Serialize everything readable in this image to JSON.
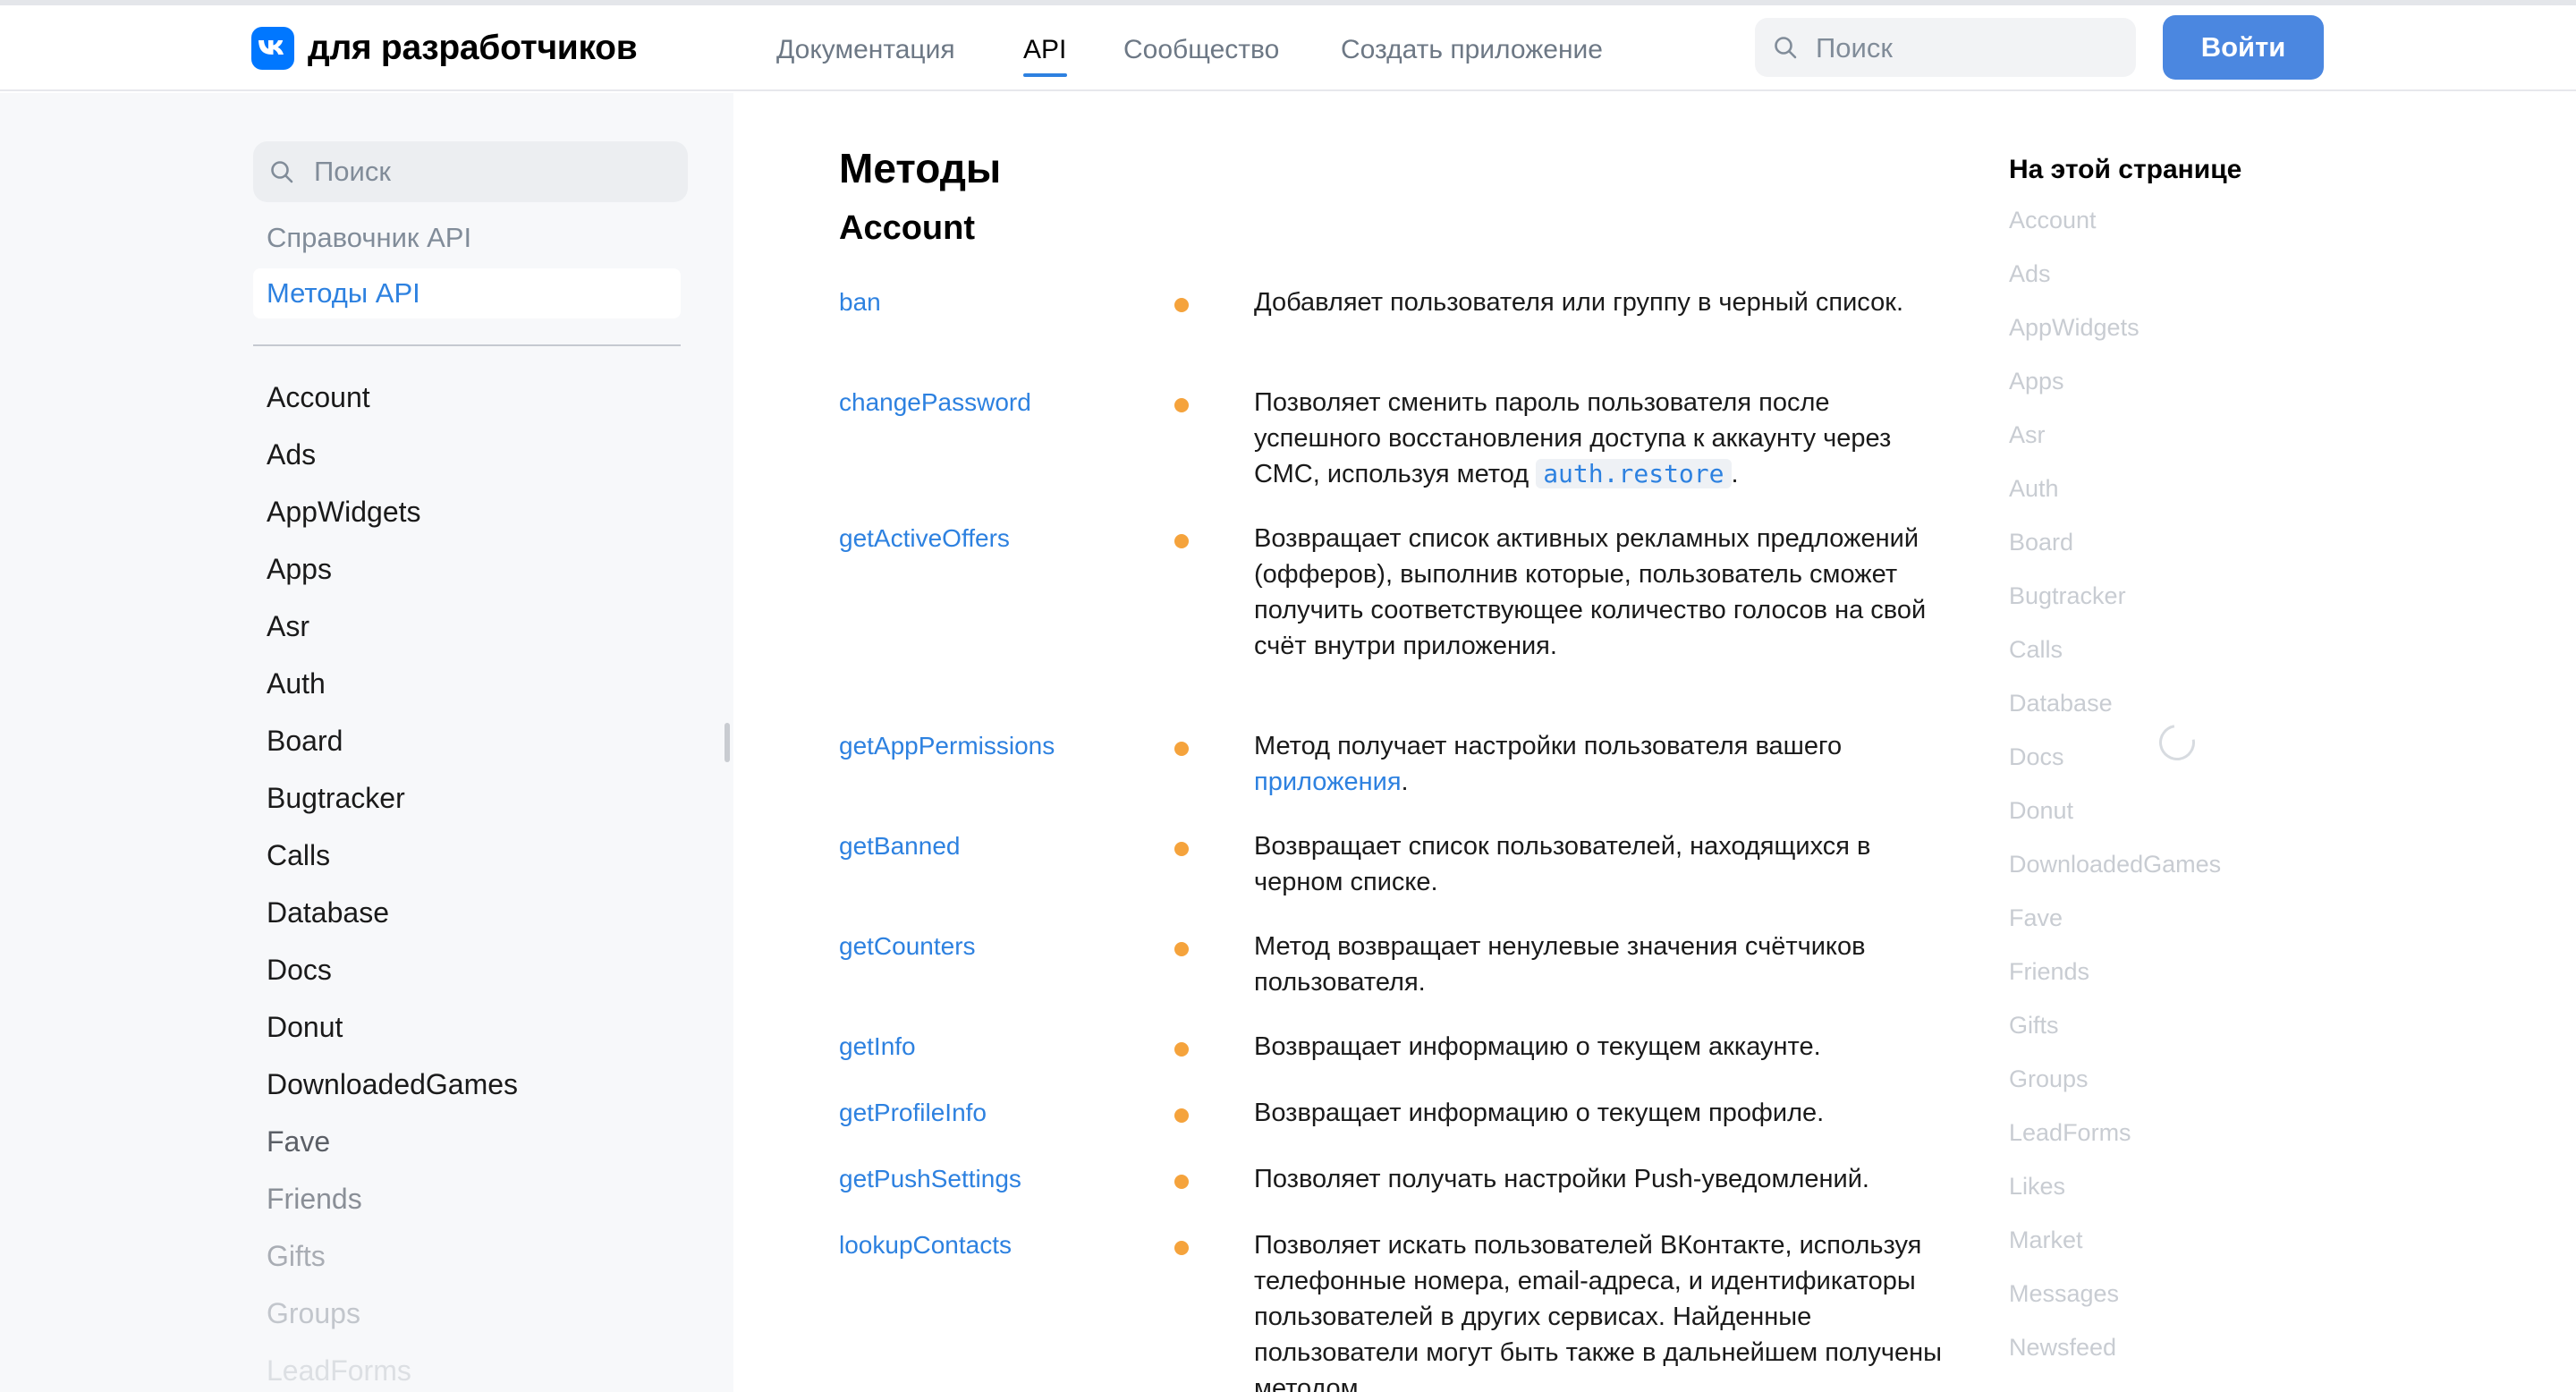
{
  "header": {
    "logo_text": "для разработчиков",
    "nav": [
      "Документация",
      "API",
      "Сообщество",
      "Создать приложение"
    ],
    "search_placeholder": "Поиск",
    "login_label": "Войти"
  },
  "sidebar": {
    "search_placeholder": "Поиск",
    "reference_label": "Справочник API",
    "methods_label": "Методы API",
    "items": [
      "Account",
      "Ads",
      "AppWidgets",
      "Apps",
      "Asr",
      "Auth",
      "Board",
      "Bugtracker",
      "Calls",
      "Database",
      "Docs",
      "Donut",
      "DownloadedGames",
      "Fave",
      "Friends",
      "Gifts",
      "Groups",
      "LeadForms"
    ]
  },
  "main": {
    "title": "Методы",
    "section": "Account",
    "methods": [
      {
        "name": "ban",
        "desc": "Добавляет пользователя или группу в черный список."
      },
      {
        "name": "changePassword",
        "desc_before": "Позволяет сменить пароль пользователя после успешного восстановления доступа к аккаунту через СМС, используя метод ",
        "code": "auth.restore",
        "desc_after": "."
      },
      {
        "name": "getActiveOffers",
        "desc": "Возвращает список активных рекламных предложений (офферов), выполнив которые, пользователь сможет получить соответствующее количество голосов на свой счёт внутри приложения."
      },
      {
        "name": "getAppPermissions",
        "desc_before": "Метод получает настройки пользователя вашего ",
        "link": "приложения",
        "desc_after": "."
      },
      {
        "name": "getBanned",
        "desc": "Возвращает список пользователей, находящихся в черном списке."
      },
      {
        "name": "getCounters",
        "desc": "Метод возвращает ненулевые значения счётчиков пользователя."
      },
      {
        "name": "getInfo",
        "desc": "Возвращает информацию о текущем аккаунте."
      },
      {
        "name": "getProfileInfo",
        "desc": "Возвращает информацию о текущем профиле."
      },
      {
        "name": "getPushSettings",
        "desc": "Позволяет получать настройки Push-уведомлений."
      },
      {
        "name": "lookupContacts",
        "desc": "Позволяет искать пользователей ВКонтакте, используя телефонные номера, email-адреса, и идентификаторы пользователей в других сервисах. Найденные пользователи могут быть также в дальнейшем получены методом"
      }
    ]
  },
  "toc": {
    "title": "На этой странице",
    "items": [
      "Account",
      "Ads",
      "AppWidgets",
      "Apps",
      "Asr",
      "Auth",
      "Board",
      "Bugtracker",
      "Calls",
      "Database",
      "Docs",
      "Donut",
      "DownloadedGames",
      "Fave",
      "Friends",
      "Gifts",
      "Groups",
      "LeadForms",
      "Likes",
      "Market",
      "Messages",
      "Newsfeed"
    ]
  },
  "colors": {
    "accent": "#2d81e0",
    "button": "#4b87e0",
    "logo": "#0077ff",
    "dot": "#f5a33c"
  }
}
